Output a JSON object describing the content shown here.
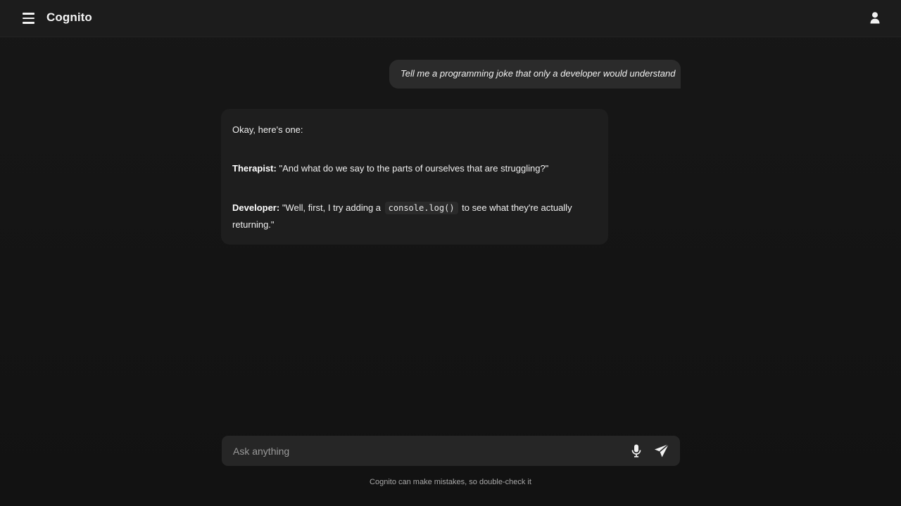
{
  "app": {
    "title": "Cognito"
  },
  "header": {
    "menu_icon": "hamburger-menu-icon",
    "profile_icon": "user-icon"
  },
  "conversation": {
    "user_message": "Tell me a programming joke that only a developer would understand",
    "assistant_message": {
      "intro": "Okay, here's one:",
      "line1_speaker": "Therapist:",
      "line1_text": " \"And what do we say to the parts of ourselves that are struggling?\"",
      "line2_speaker": "Developer:",
      "line2_text_before": " \"Well, first, I try adding a ",
      "line2_code": "console.log()",
      "line2_text_after": " to see what they're actually returning.\""
    }
  },
  "composer": {
    "placeholder": "Ask anything",
    "value": "",
    "mic_icon": "microphone-icon",
    "send_icon": "send-icon"
  },
  "footer": {
    "disclaimer": "Cognito can make mistakes, so double-check it"
  }
}
